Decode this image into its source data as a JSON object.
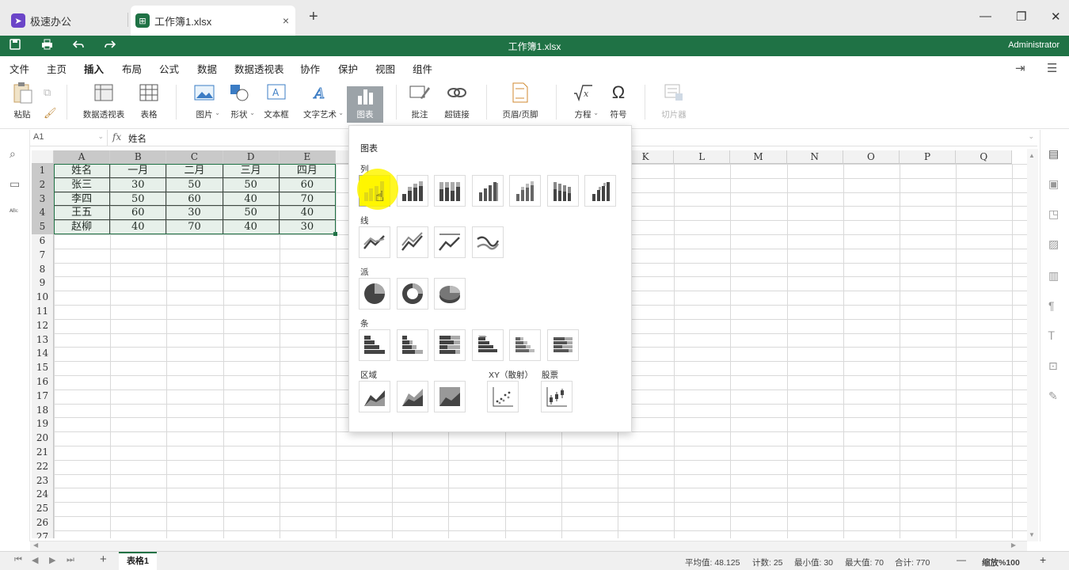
{
  "tabs": {
    "home_label": "极速办公",
    "file_label": "工作簿1.xlsx",
    "close_glyph": "×",
    "new_glyph": "+"
  },
  "window": {
    "minimize": "—",
    "restore": "❐",
    "close": "✕"
  },
  "titlebar": {
    "doc_title": "工作簿1.xlsx",
    "user": "Administrator"
  },
  "menu": [
    "文件",
    "主页",
    "插入",
    "布局",
    "公式",
    "数据",
    "数据透视表",
    "协作",
    "保护",
    "视图",
    "组件"
  ],
  "menu_active": "插入",
  "ribbon": {
    "paste": "粘贴",
    "pivot": "数据透视表",
    "table": "表格",
    "image": "图片",
    "shape": "形状",
    "textbox": "文本框",
    "wordart": "文字艺术",
    "chart": "图表",
    "comment": "批注",
    "hyperlink": "超链接",
    "header_footer": "页眉/页脚",
    "equation": "方程",
    "symbol": "符号",
    "slicer": "切片器"
  },
  "formula_bar": {
    "name_box": "A1",
    "fx": "fx",
    "content": "姓名"
  },
  "columns": [
    "A",
    "B",
    "C",
    "D",
    "E",
    "F",
    "G",
    "H",
    "I",
    "J",
    "K",
    "L",
    "M",
    "N",
    "O",
    "P",
    "Q"
  ],
  "rows": [
    "1",
    "2",
    "3",
    "4",
    "5",
    "6",
    "7",
    "8",
    "9",
    "10",
    "11",
    "12",
    "13",
    "14",
    "15",
    "16",
    "17",
    "18",
    "19",
    "20",
    "21",
    "22",
    "23",
    "24",
    "25",
    "26",
    "27"
  ],
  "table": [
    [
      "姓名",
      "一月",
      "二月",
      "三月",
      "四月"
    ],
    [
      "张三",
      "30",
      "50",
      "50",
      "60"
    ],
    [
      "李四",
      "50",
      "60",
      "40",
      "70"
    ],
    [
      "王五",
      "60",
      "30",
      "50",
      "40"
    ],
    [
      "赵柳",
      "40",
      "70",
      "40",
      "30"
    ]
  ],
  "chart_menu": {
    "title": "图表",
    "section_column": "列",
    "section_line": "线",
    "section_pie": "派",
    "section_bar": "条",
    "section_area": "区域",
    "section_xy": "XY（散射）",
    "section_stock": "股票"
  },
  "status": {
    "sheet": "表格1",
    "average": "平均值: 48.125",
    "count": "计数: 25",
    "min": "最小值: 30",
    "max": "最大值: 70",
    "sum": "合计: 770",
    "zoom": "缩放%100",
    "zoom_out": "—",
    "zoom_in": "+",
    "add_sheet": "+"
  },
  "colors": {
    "brand": "#1f7245",
    "highlight": "#fbf500",
    "chart_icon": "#2e2e9a"
  }
}
